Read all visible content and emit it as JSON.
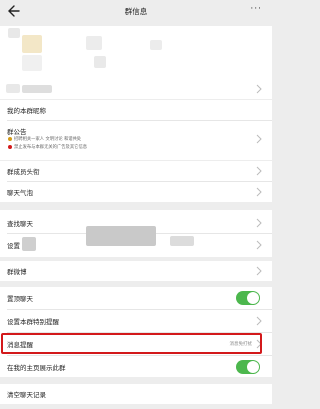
{
  "header": {
    "title": "群信息",
    "more": "···"
  },
  "member_section": {},
  "group_info": {
    "nickname_label": "我的本群昵称",
    "announcement_label": "群公告",
    "announcement_lines": [
      "招聘相关一家人 文明讨论 和谐共处",
      "禁止发布与本群无关的广告及其它信息"
    ]
  },
  "rows1": {
    "member_avatar_label": "群成员头衔",
    "chat_bubble_label": "聊天气泡"
  },
  "rows2": {
    "find_chat_label": "查找聊天",
    "settings_label": "设置"
  },
  "rows3": {
    "weibo_label": "群微博"
  },
  "rows4": {
    "pin_label": "置顶聊天",
    "special_remind_label": "设置本群特别提醒",
    "mute_label": "消息提醒",
    "mute_value": "消息免打扰",
    "show_home_label": "在我的主页展示此群"
  },
  "rows5": {
    "clear_label": "清空聊天记录"
  },
  "colors": {
    "toggle": "#4cb74d",
    "highlight": "#d3191b",
    "warn": "#d39b19"
  },
  "icons": [
    "back-arrow-icon",
    "more-icon",
    "chevron-right-icon",
    "toggle-switch"
  ]
}
